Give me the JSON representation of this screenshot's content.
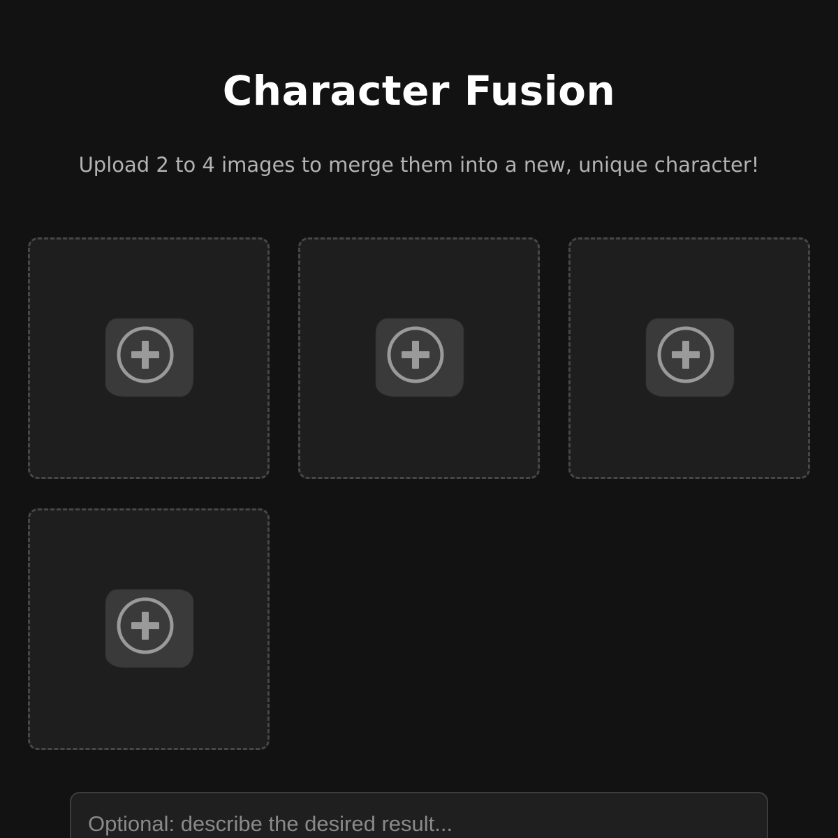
{
  "page": {
    "title": "Character Fusion",
    "subtitle": "Upload 2 to 4 images to merge them into a new, unique character!"
  },
  "upload_slots": [
    {
      "icon": "add-circle-icon"
    },
    {
      "icon": "add-circle-icon"
    },
    {
      "icon": "add-circle-icon"
    },
    {
      "icon": "add-circle-icon"
    }
  ],
  "prompt": {
    "placeholder": "Optional: describe the desired result...",
    "value": ""
  },
  "colors": {
    "background": "#121212",
    "slot_background": "#1e1e1e",
    "slot_border": "#474747",
    "icon": "#9a9a9a",
    "subtitle": "#b3b3b3"
  }
}
